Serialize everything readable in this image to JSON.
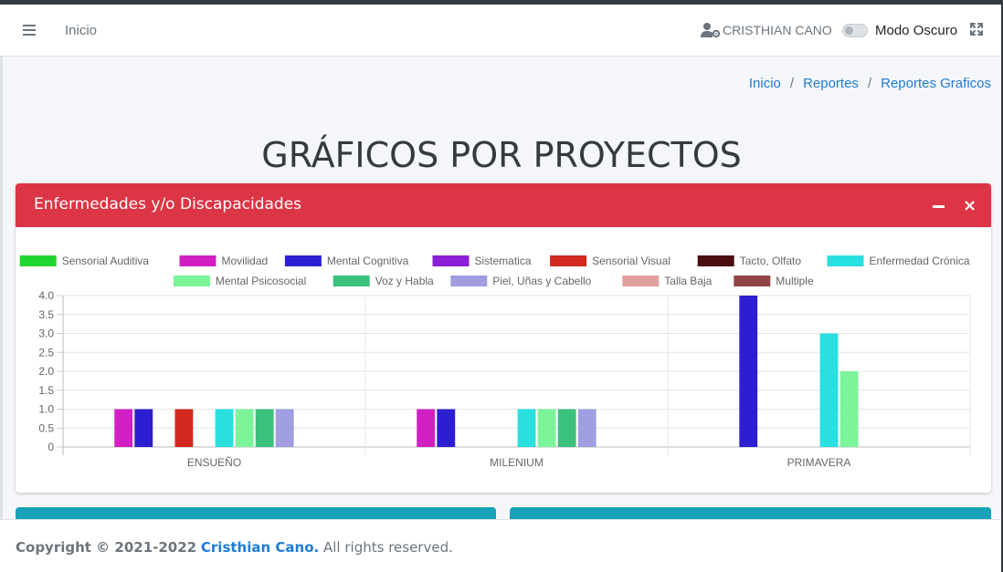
{
  "navbar": {
    "home_label": "Inicio",
    "user_name": "CRISTHIAN CANO",
    "dark_mode_label": "Modo Oscuro"
  },
  "breadcrumb": {
    "items": [
      "Inicio",
      "Reportes",
      "Reportes Graficos"
    ],
    "separator": "/"
  },
  "page_title": "GRÁFICOS POR PROYECTOS",
  "card": {
    "title": "Enfermedades y/o Discapacidades"
  },
  "chart_data": {
    "type": "bar",
    "categories": [
      "ENSUEÑO",
      "MILENIUM",
      "PRIMAVERA"
    ],
    "ylim": [
      0,
      4
    ],
    "yticks": [
      "4.0",
      "3.5",
      "3.0",
      "2.5",
      "2.0",
      "1.5",
      "1.0",
      "0.5",
      "0"
    ],
    "grid": true,
    "legend": "top",
    "series": [
      {
        "name": "Sensorial Auditiva",
        "color": "#1fd630",
        "values": [
          0,
          0,
          0
        ]
      },
      {
        "name": "Movilidad",
        "color": "#d11fc4",
        "values": [
          1,
          1,
          0
        ]
      },
      {
        "name": "Mental Cognitiva",
        "color": "#2b1fd1",
        "values": [
          1,
          1,
          4
        ]
      },
      {
        "name": "Sistematica",
        "color": "#8a1fd6",
        "values": [
          0,
          0,
          0
        ]
      },
      {
        "name": "Sensorial Visual",
        "color": "#d1281f",
        "values": [
          1,
          0,
          0
        ]
      },
      {
        "name": "Tacto, Olfato",
        "color": "#4a0e0e",
        "values": [
          0,
          0,
          0
        ]
      },
      {
        "name": "Enfermedad Crónica",
        "color": "#2adfdf",
        "values": [
          1,
          1,
          3
        ]
      },
      {
        "name": "Mental Psicosocial",
        "color": "#7cf49a",
        "values": [
          1,
          1,
          2
        ]
      },
      {
        "name": "Voz y Habla",
        "color": "#3cc07e",
        "values": [
          1,
          1,
          0
        ]
      },
      {
        "name": "Piel, Uñas y Cabello",
        "color": "#a09ee0",
        "values": [
          1,
          1,
          0
        ]
      },
      {
        "name": "Talla Baja",
        "color": "#e0a09e",
        "values": [
          0,
          0,
          0
        ]
      },
      {
        "name": "Multiple",
        "color": "#914545",
        "values": [
          0,
          0,
          0
        ]
      }
    ]
  },
  "footer": {
    "copyright": "Copyright © 2021-2022",
    "author": "Cristhian Cano.",
    "rights": "All rights reserved."
  },
  "colors": {
    "accent": "#1e7cd6",
    "card_header": "#dc3545",
    "info": "#17a2b8"
  }
}
